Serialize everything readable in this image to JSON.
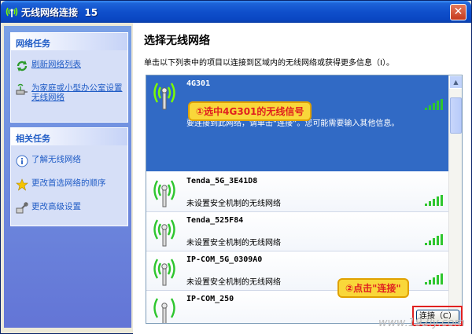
{
  "window": {
    "title": "无线网络连接  15",
    "close_label": "✕"
  },
  "left_pane": {
    "network_tasks": {
      "header": "网络任务",
      "items": [
        {
          "label": "刷新网络列表"
        },
        {
          "label": "为家庭或小型办公室设置无线网络"
        }
      ]
    },
    "related_tasks": {
      "header": "相关任务",
      "items": [
        {
          "label": "了解无线网络"
        },
        {
          "label": "更改首选网络的顺序"
        },
        {
          "label": "更改高级设置"
        }
      ]
    }
  },
  "main": {
    "title": "选择无线网络",
    "description": "单击以下列表中的项目以连接到区域内的无线网络或获得更多信息（I）。",
    "networks": [
      {
        "ssid": "4G301",
        "detail": "要连接到此网络，请单击“连接”。您可能需要输入其他信息。",
        "selected": true,
        "signal": 5
      },
      {
        "ssid": "Tenda_5G_3E41D8",
        "status": "未设置安全机制的无线网络",
        "signal": 5
      },
      {
        "ssid": "Tenda_525F84",
        "status": "未设置安全机制的无线网络",
        "signal": 5
      },
      {
        "ssid": "IP-COM_5G_0309A0",
        "status": "未设置安全机制的无线网络",
        "signal": 5
      },
      {
        "ssid": "IP-COM_250"
      }
    ],
    "connect_button": "连接（C）"
  },
  "annotations": {
    "step1": "①选中4G301的无线信号",
    "step2": "②点击\"连接\""
  },
  "watermark": "www.192ly.com",
  "colors": {
    "selection": "#316ac5",
    "link": "#215dc6",
    "callout_bg": "#f9d73a",
    "callout_text": "#e02020"
  }
}
